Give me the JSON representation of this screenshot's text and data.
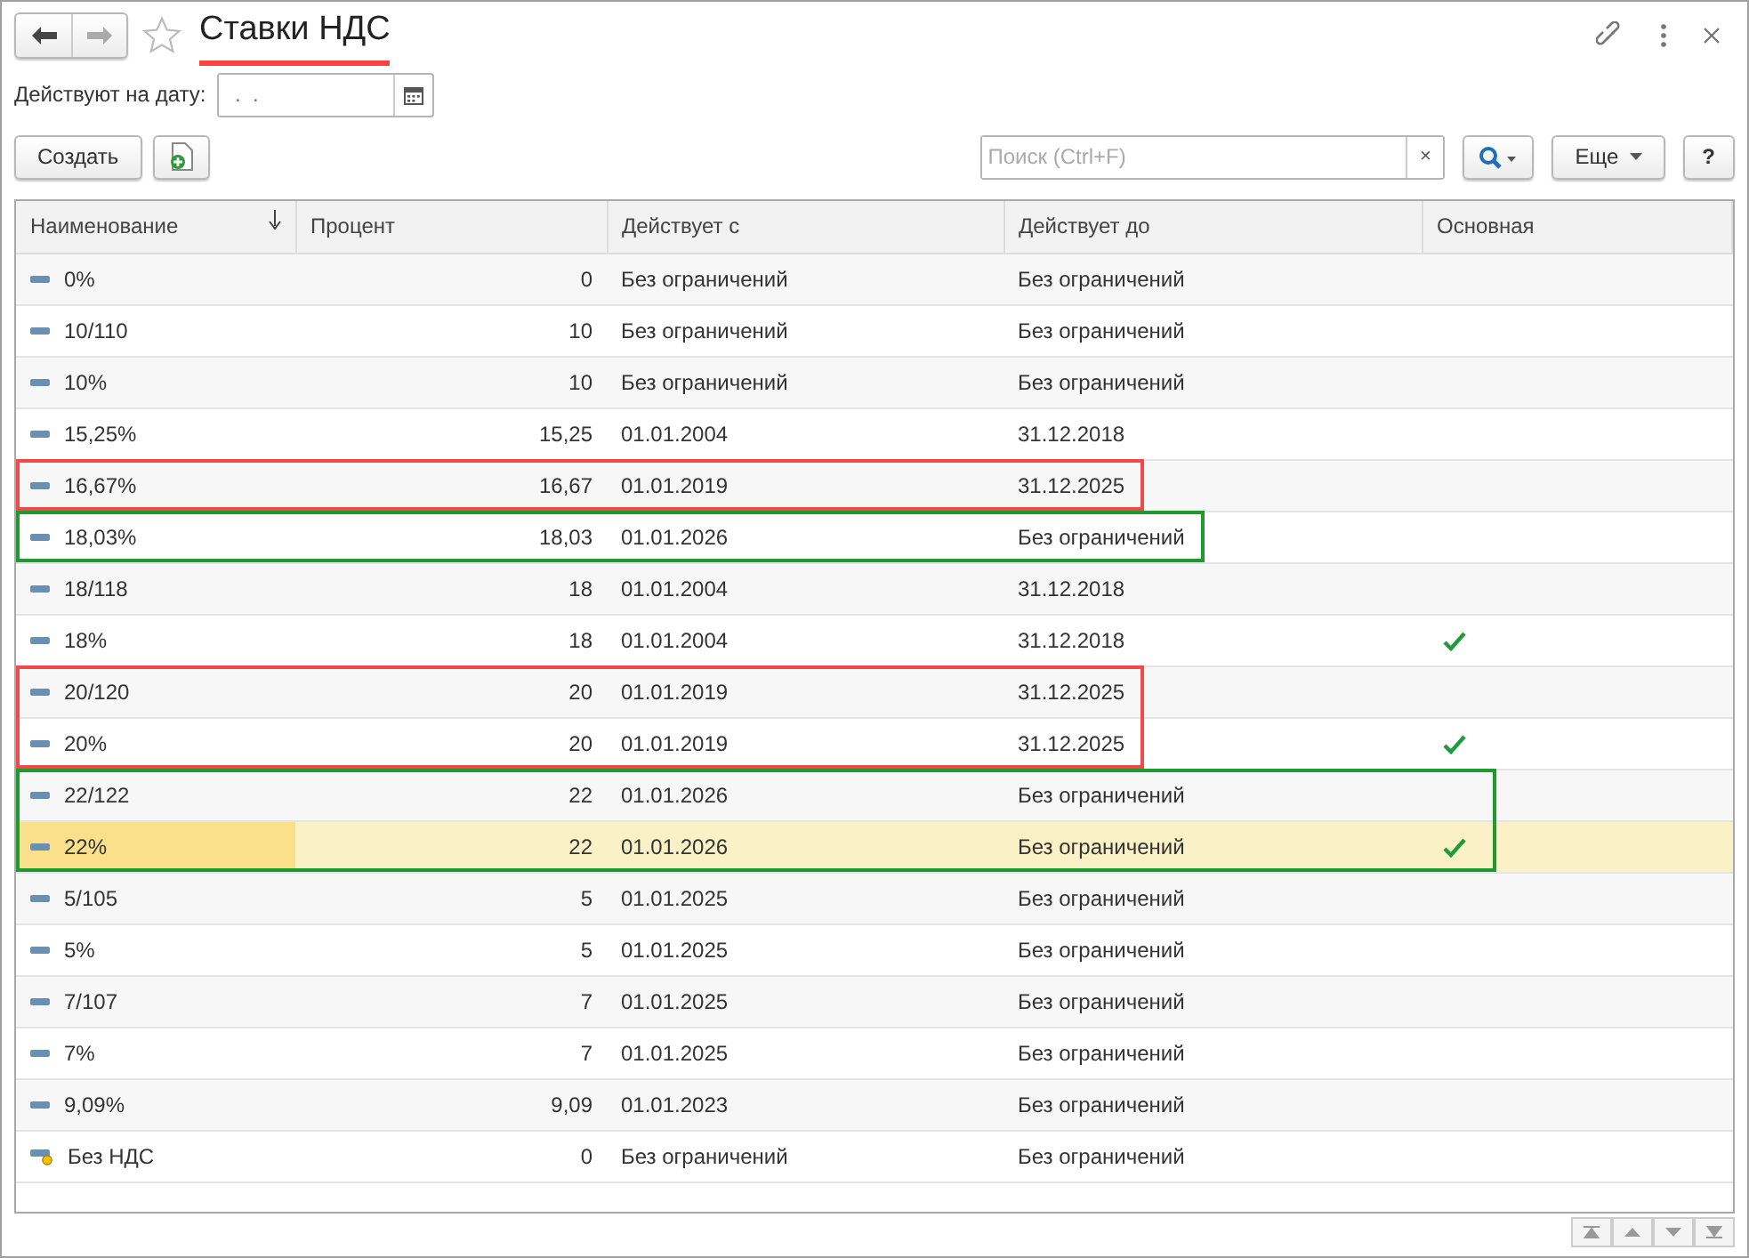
{
  "window": {
    "title": "Ставки НДС",
    "title_underlined": true
  },
  "date_filter": {
    "label": "Действуют на дату:",
    "placeholder": " .  . "
  },
  "toolbar": {
    "create": "Создать",
    "search_placeholder": "Поиск (Ctrl+F)",
    "clear": "×",
    "more": "Еще",
    "help": "?"
  },
  "table": {
    "columns": [
      {
        "label": "Наименование",
        "sorted": true
      },
      {
        "label": "Процент",
        "sorted": false
      },
      {
        "label": "Действует с",
        "sorted": false
      },
      {
        "label": "Действует до",
        "sorted": false
      },
      {
        "label": "Основная",
        "sorted": false
      }
    ],
    "rows": [
      {
        "kind": "plain",
        "name": "0%",
        "percent": "0",
        "from": "Без ограничений",
        "to": "Без ограничений",
        "main": false,
        "selected": false
      },
      {
        "kind": "plain",
        "name": "10/110",
        "percent": "10",
        "from": "Без ограничений",
        "to": "Без ограничений",
        "main": false,
        "selected": false
      },
      {
        "kind": "plain",
        "name": "10%",
        "percent": "10",
        "from": "Без ограничений",
        "to": "Без ограничений",
        "main": false,
        "selected": false
      },
      {
        "kind": "plain",
        "name": "15,25%",
        "percent": "15,25",
        "from": "01.01.2004",
        "to": "31.12.2018",
        "main": false,
        "selected": false
      },
      {
        "kind": "plain",
        "name": "16,67%",
        "percent": "16,67",
        "from": "01.01.2019",
        "to": "31.12.2025",
        "main": false,
        "selected": false,
        "frame": {
          "color": "#f04a4a",
          "covers_main": false
        }
      },
      {
        "kind": "plain",
        "name": "18,03%",
        "percent": "18,03",
        "from": "01.01.2026",
        "to": "Без ограничений",
        "main": false,
        "selected": false,
        "frame": {
          "color": "#1f9a2e",
          "covers_main": false
        }
      },
      {
        "kind": "plain",
        "name": "18/118",
        "percent": "18",
        "from": "01.01.2004",
        "to": "31.12.2018",
        "main": false,
        "selected": false
      },
      {
        "kind": "plain",
        "name": "18%",
        "percent": "18",
        "from": "01.01.2004",
        "to": "31.12.2018",
        "main": true,
        "selected": false
      },
      {
        "kind": "plain",
        "name": "20/120",
        "percent": "20",
        "from": "01.01.2019",
        "to": "31.12.2025",
        "main": false,
        "selected": false,
        "frame": {
          "color": "#f04a4a",
          "covers_main": false
        }
      },
      {
        "kind": "plain",
        "name": "20%",
        "percent": "20",
        "from": "01.01.2019",
        "to": "31.12.2025",
        "main": true,
        "selected": false,
        "frame": {
          "color": "#f04a4a",
          "covers_main": false
        }
      },
      {
        "kind": "plain",
        "name": "22/122",
        "percent": "22",
        "from": "01.01.2026",
        "to": "Без ограничений",
        "main": false,
        "selected": false,
        "frame": {
          "color": "#1f9a2e",
          "covers_main": true
        }
      },
      {
        "kind": "plain",
        "name": "22%",
        "percent": "22",
        "from": "01.01.2026",
        "to": "Без ограничений",
        "main": true,
        "selected": true,
        "frame": {
          "color": "#1f9a2e",
          "covers_main": true
        }
      },
      {
        "kind": "plain",
        "name": "5/105",
        "percent": "5",
        "from": "01.01.2025",
        "to": "Без ограничений",
        "main": false,
        "selected": false
      },
      {
        "kind": "plain",
        "name": "5%",
        "percent": "5",
        "from": "01.01.2025",
        "to": "Без ограничений",
        "main": false,
        "selected": false
      },
      {
        "kind": "plain",
        "name": "7/107",
        "percent": "7",
        "from": "01.01.2025",
        "to": "Без ограничений",
        "main": false,
        "selected": false
      },
      {
        "kind": "plain",
        "name": "7%",
        "percent": "7",
        "from": "01.01.2025",
        "to": "Без ограничений",
        "main": false,
        "selected": false
      },
      {
        "kind": "plain",
        "name": "9,09%",
        "percent": "9,09",
        "from": "01.01.2023",
        "to": "Без ограничений",
        "main": false,
        "selected": false
      },
      {
        "kind": "predefined",
        "name": "Без НДС",
        "percent": "0",
        "from": "Без ограничений",
        "to": "Без ограничений",
        "main": false,
        "selected": false
      }
    ]
  }
}
